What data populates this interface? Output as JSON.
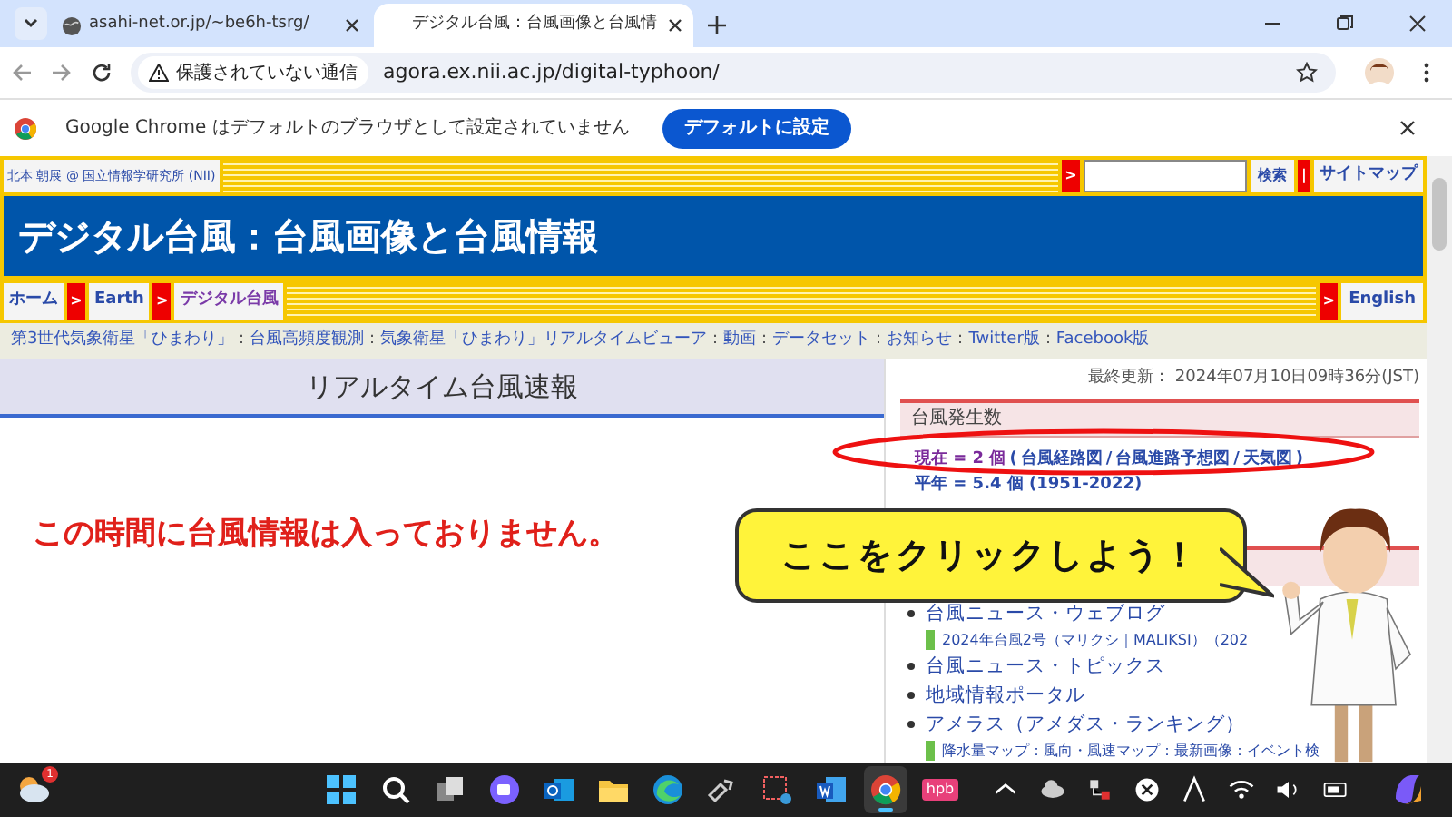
{
  "browser": {
    "tabs": [
      {
        "title": "asahi-net.or.jp/~be6h-tsrg/",
        "selected": false
      },
      {
        "title": "デジタル台風：台風画像と台風情",
        "selected": true
      }
    ],
    "address": {
      "security_label": "保護されていない通信",
      "url": "agora.ex.nii.ac.jp/digital-typhoon/"
    },
    "infobar": {
      "message": "Google Chrome はデフォルトのブラウザとして設定されていません",
      "button": "デフォルトに設定"
    }
  },
  "page": {
    "credit": "北本 朝展 @ 国立情報学研究所 (NII)",
    "search_arrow": ">",
    "search_button": "検索",
    "divider": "|",
    "sitemap": "サイトマップ",
    "title": "デジタル台風：台風画像と台風情報",
    "breadcrumbs": [
      "ホーム",
      "Earth",
      "デジタル台風"
    ],
    "breadcrumb_separator": ">",
    "english": "English",
    "links": [
      "第3世代気象衛星「ひまわり」",
      "台風高頻度観測",
      "気象衛星「ひまわり」リアルタイムビューア",
      "動画",
      "データセット",
      "お知らせ",
      "Twitter版",
      "Facebook版"
    ],
    "link_separator": "：",
    "section_title": "リアルタイム台風速報",
    "notice": "この時間に台風情報は入っておりません。",
    "last_updated": "最終更新： 2024年07月10日09時36分(JST)",
    "count_heading": "台風発生数",
    "current": {
      "label": "現在 = 2 個",
      "open": "(",
      "links": [
        "台風経路図",
        "台風進路予想図",
        "天気図"
      ],
      "separator": "/",
      "close": ")"
    },
    "average": "平年 = 5.4 個 (1951-2022)",
    "list": [
      {
        "kind": "bullet",
        "text": "台風ニュース・ウェブログ"
      },
      {
        "kind": "sub",
        "text": "2024年台風2号（マリクシ｜MALIKSI）（202"
      },
      {
        "kind": "bullet",
        "text": "台風ニュース・トピックス"
      },
      {
        "kind": "bullet",
        "text": "地域情報ポータル"
      },
      {
        "kind": "bullet",
        "text": "アメラス（アメダス・ランキング）"
      },
      {
        "kind": "sub",
        "text": "降水量マップ：風向・風速マップ：最新画像：イベント検"
      }
    ],
    "callout": "ここをクリックしよう！"
  },
  "taskbar": {
    "badge": "1",
    "apps": [
      {
        "kind": "start",
        "selected": false
      },
      {
        "kind": "search",
        "selected": false
      },
      {
        "kind": "taskview",
        "selected": false
      },
      {
        "kind": "teams",
        "selected": false
      },
      {
        "kind": "outlook",
        "selected": false
      },
      {
        "kind": "folder",
        "selected": false
      },
      {
        "kind": "edge",
        "selected": false
      },
      {
        "kind": "tool",
        "selected": false
      },
      {
        "kind": "snip",
        "selected": false
      },
      {
        "kind": "word",
        "selected": false
      },
      {
        "kind": "chrome",
        "selected": true
      },
      {
        "kind": "hpb",
        "selected": false,
        "label": "hpb"
      }
    ]
  }
}
